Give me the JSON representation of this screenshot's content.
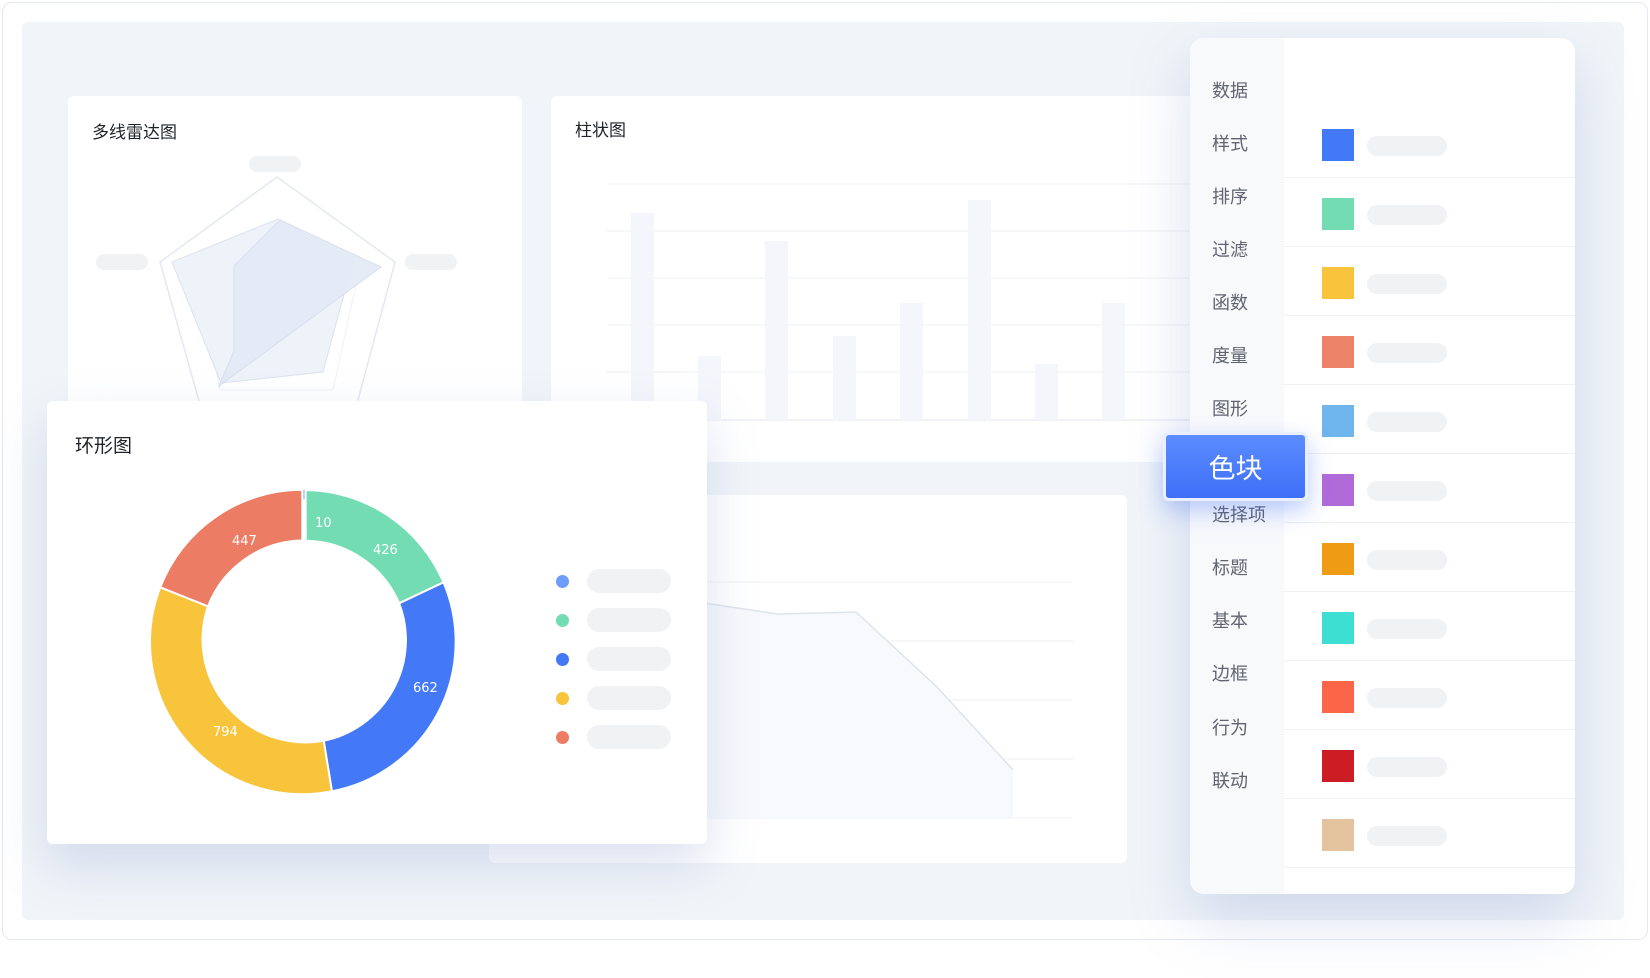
{
  "radar": {
    "title": "多线雷达图"
  },
  "bar": {
    "title": "柱状图"
  },
  "donut": {
    "title": "环形图",
    "values": [
      "10",
      "426",
      "662",
      "794",
      "447"
    ]
  },
  "menu": {
    "items": [
      "数据",
      "样式",
      "排序",
      "过滤",
      "函数",
      "度量",
      "图形",
      "选择项",
      "标题",
      "基本",
      "边框",
      "行为",
      "联动"
    ],
    "active": "色块"
  },
  "swatches": [
    "#4379f7",
    "#74dcb3",
    "#f7c43c",
    "#ec8268",
    "#6fb5ee",
    "#b16bd9",
    "#ef9c15",
    "#3cdfd2",
    "#fb6648",
    "#cc1c24",
    "#e3c49e"
  ],
  "legend_colors": [
    "#6f9cf7",
    "#74dcb3",
    "#4379f7",
    "#f7c43c",
    "#ec7c64"
  ],
  "donut_colors": [
    "#9db7f5",
    "#74dcb3",
    "#4379f7",
    "#f7c43c",
    "#ec7c64"
  ]
}
